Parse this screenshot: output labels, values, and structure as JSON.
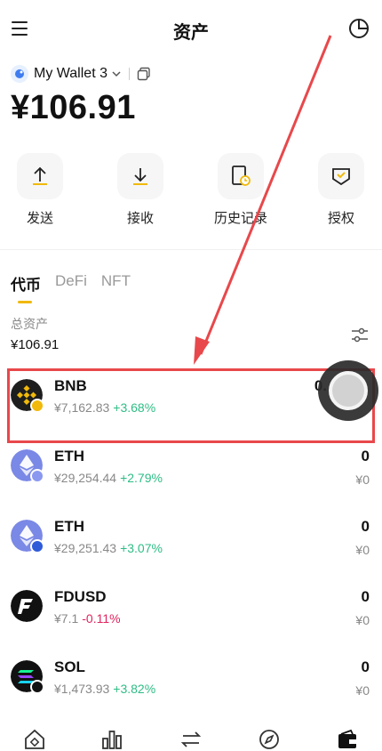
{
  "header": {
    "title": "资产"
  },
  "wallet": {
    "name": "My Wallet 3",
    "balance": "¥106.91"
  },
  "actions": [
    {
      "label": "发送",
      "icon": "send-icon"
    },
    {
      "label": "接收",
      "icon": "receive-icon"
    },
    {
      "label": "历史记录",
      "icon": "history-icon"
    },
    {
      "label": "授权",
      "icon": "authorize-icon"
    }
  ],
  "tabs": [
    {
      "label": "代币",
      "active": true
    },
    {
      "label": "DeFi",
      "active": false
    },
    {
      "label": "NFT",
      "active": false
    }
  ],
  "summary": {
    "label": "总资产",
    "value": "¥106.91"
  },
  "tokens": [
    {
      "name": "BNB",
      "price": "¥7,162.83",
      "change": "+3.68%",
      "amount": "0.",
      "value": "",
      "color": "#1e1e1e",
      "badge": "#f0b90b"
    },
    {
      "name": "ETH",
      "price": "¥29,254.44",
      "change": "+2.79%",
      "amount": "0",
      "value": "¥0",
      "color": "#6f7fe0",
      "badge": "#8b98f0"
    },
    {
      "name": "ETH",
      "price": "¥29,251.43",
      "change": "+3.07%",
      "amount": "0",
      "value": "¥0",
      "color": "#6f7fe0",
      "badge": "#2f5bd8"
    },
    {
      "name": "FDUSD",
      "price": "¥7.1",
      "change": "-0.11%",
      "amount": "0",
      "value": "¥0",
      "color": "#111111",
      "badge": ""
    },
    {
      "name": "SOL",
      "price": "¥1,473.93",
      "change": "+3.82%",
      "amount": "0",
      "value": "¥0",
      "color": "#111111",
      "badge": "#111111"
    }
  ],
  "bottom_nav": [
    "home-icon",
    "market-icon",
    "swap-icon",
    "discover-icon",
    "wallet-icon"
  ],
  "colors": {
    "accent": "#f0b90b",
    "positive": "#2ebd85",
    "negative": "#e0245e",
    "highlight": "#e8484b"
  }
}
